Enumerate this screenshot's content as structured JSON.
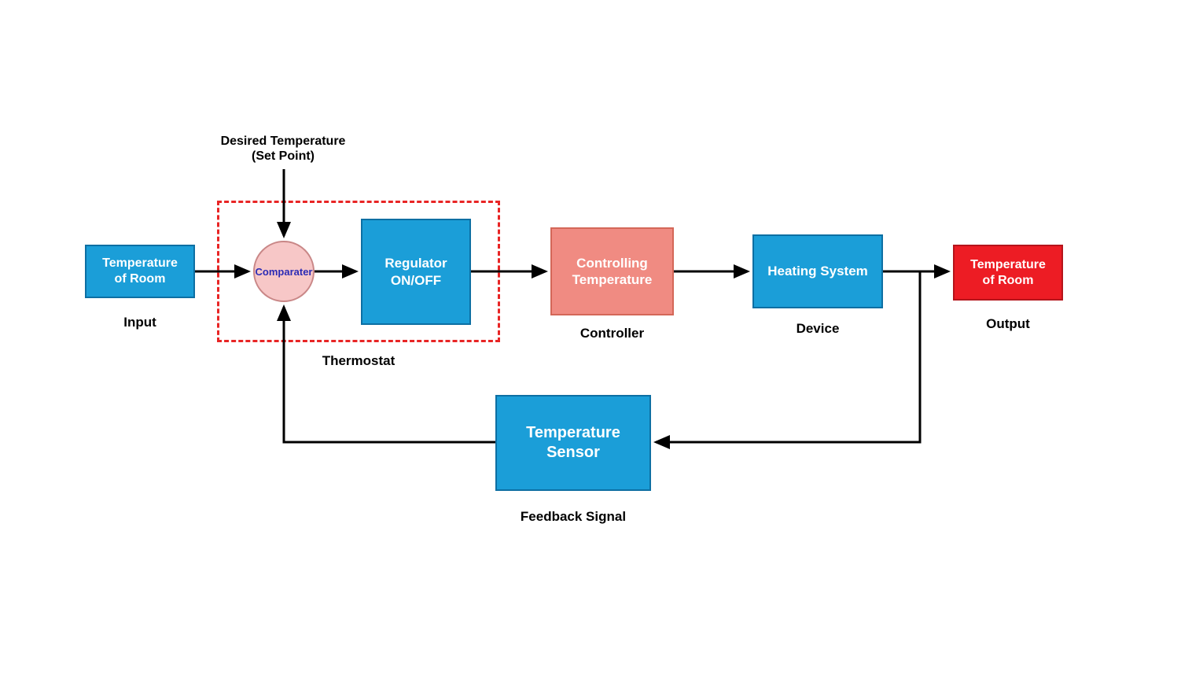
{
  "blocks": {
    "input": {
      "title": "Temperature\nof Room",
      "caption": "Input"
    },
    "comparator": {
      "title": "Comparater"
    },
    "regulator": {
      "title": "Regulator\nON/OFF"
    },
    "controller": {
      "title": "Controlling\nTemperature",
      "caption": "Controller"
    },
    "device": {
      "title": "Heating System",
      "caption": "Device"
    },
    "output": {
      "title": "Temperature\nof Room",
      "caption": "Output"
    },
    "sensor": {
      "title": "Temperature\nSensor",
      "caption": "Feedback Signal"
    }
  },
  "labels": {
    "setpoint_line1": "Desired Temperature",
    "setpoint_line2": "(Set Point)",
    "thermostat": "Thermostat"
  },
  "colors": {
    "blue": "#1b9ed8",
    "coral": "#f08b82",
    "red": "#ed1c24",
    "pink": "#f7c7c7",
    "dash": "#e82525"
  }
}
